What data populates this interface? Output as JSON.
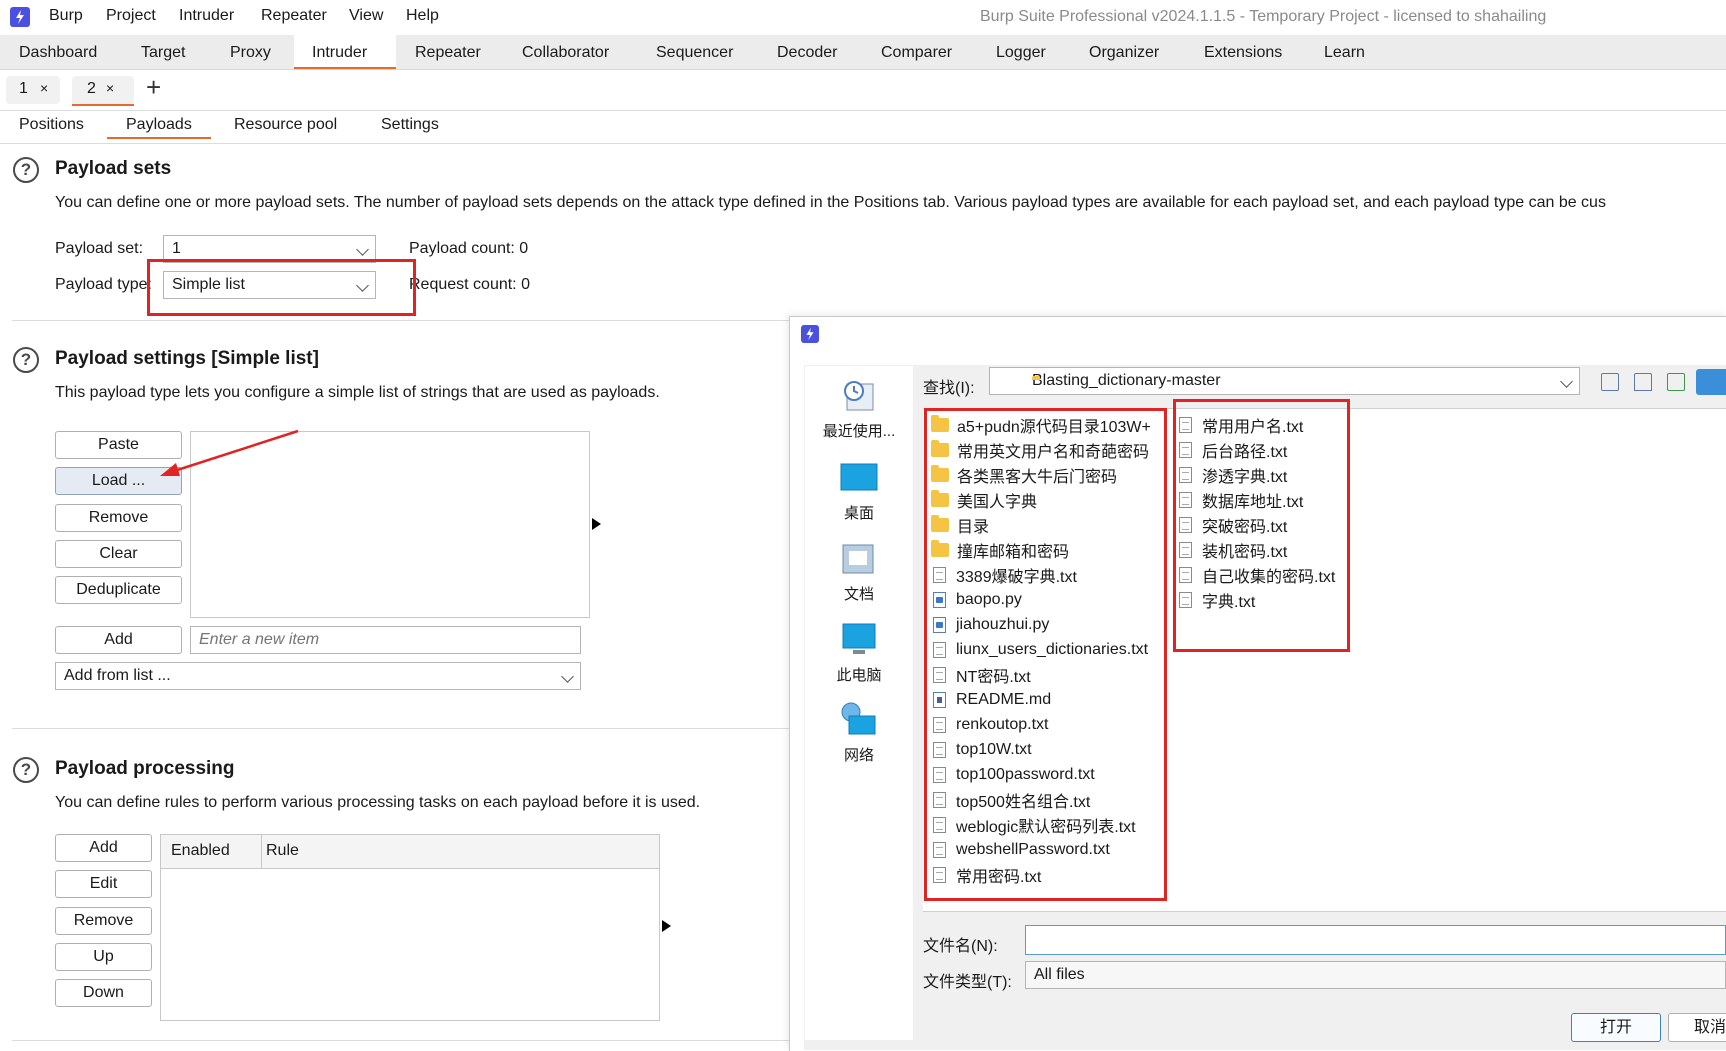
{
  "menubar": {
    "items": [
      "Burp",
      "Project",
      "Intruder",
      "Repeater",
      "View",
      "Help"
    ],
    "window_title": "Burp Suite Professional v2024.1.1.5 - Temporary Project - licensed to shahailing"
  },
  "main_tabs": [
    "Dashboard",
    "Target",
    "Proxy",
    "Intruder",
    "Repeater",
    "Collaborator",
    "Sequencer",
    "Decoder",
    "Comparer",
    "Logger",
    "Organizer",
    "Extensions",
    "Learn"
  ],
  "main_tab_active": "Intruder",
  "instance_tabs": [
    {
      "label": "1",
      "close": "×"
    },
    {
      "label": "2",
      "close": "×"
    }
  ],
  "instance_add": "+",
  "sub_tabs": [
    "Positions",
    "Payloads",
    "Resource pool",
    "Settings"
  ],
  "sub_tab_active": "Payloads",
  "payload_sets": {
    "help": "?",
    "title": "Payload sets",
    "description": "You can define one or more payload sets. The number of payload sets depends on the attack type defined in the Positions tab. Various payload types are available for each payload set, and each payload type can be cus",
    "set_label": "Payload set:",
    "set_value": "1",
    "type_label": "Payload type:",
    "type_value": "Simple list",
    "payload_count": "Payload count: 0",
    "request_count": "Request count: 0"
  },
  "payload_settings": {
    "help": "?",
    "title": "Payload settings [Simple list]",
    "description": "This payload type lets you configure a simple list of strings that are used as payloads.",
    "buttons": [
      "Paste",
      "Load ...",
      "Remove",
      "Clear",
      "Deduplicate"
    ],
    "add_button": "Add",
    "add_placeholder": "Enter a new item",
    "add_from_list": "Add from list ..."
  },
  "payload_processing": {
    "help": "?",
    "title": "Payload processing",
    "description": "You can define rules to perform various processing tasks on each payload before it is used.",
    "buttons": [
      "Add",
      "Edit",
      "Remove",
      "Up",
      "Down"
    ],
    "columns": [
      "Enabled",
      "Rule"
    ]
  },
  "file_dialog": {
    "look_in_label": "查找(I):",
    "look_in_value": "Blasting_dictionary-master",
    "places": [
      "最近使用...",
      "桌面",
      "文档",
      "此电脑",
      "网络"
    ],
    "files_left": [
      {
        "name": "a5+pudn源代码目录103W+",
        "type": "folder"
      },
      {
        "name": "常用英文用户名和奇葩密码",
        "type": "folder"
      },
      {
        "name": "各类黑客大牛后门密码",
        "type": "folder"
      },
      {
        "name": "美国人字典",
        "type": "folder"
      },
      {
        "name": "目录",
        "type": "folder"
      },
      {
        "name": "撞库邮箱和密码",
        "type": "folder"
      },
      {
        "name": "3389爆破字典.txt",
        "type": "txt"
      },
      {
        "name": "baopo.py",
        "type": "py"
      },
      {
        "name": "jiahouzhui.py",
        "type": "py"
      },
      {
        "name": "liunx_users_dictionaries.txt",
        "type": "txt"
      },
      {
        "name": "NT密码.txt",
        "type": "txt"
      },
      {
        "name": "README.md",
        "type": "md"
      },
      {
        "name": "renkoutop.txt",
        "type": "txt"
      },
      {
        "name": "top10W.txt",
        "type": "txt"
      },
      {
        "name": "top100password.txt",
        "type": "txt"
      },
      {
        "name": "top500姓名组合.txt",
        "type": "txt"
      },
      {
        "name": "weblogic默认密码列表.txt",
        "type": "txt"
      },
      {
        "name": "webshellPassword.txt",
        "type": "txt"
      },
      {
        "name": "常用密码.txt",
        "type": "txt"
      }
    ],
    "files_right": [
      {
        "name": "常用用户名.txt",
        "type": "txt"
      },
      {
        "name": "后台路径.txt",
        "type": "txt"
      },
      {
        "name": "渗透字典.txt",
        "type": "txt"
      },
      {
        "name": "数据库地址.txt",
        "type": "txt"
      },
      {
        "name": "突破密码.txt",
        "type": "txt"
      },
      {
        "name": "装机密码.txt",
        "type": "txt"
      },
      {
        "name": "自己收集的密码.txt",
        "type": "txt"
      },
      {
        "name": "字典.txt",
        "type": "txt"
      }
    ],
    "filename_label": "文件名(N):",
    "filename_value": "",
    "filetype_label": "文件类型(T):",
    "filetype_value": "All files",
    "open_button": "打开",
    "cancel_button": "取消"
  },
  "colors": {
    "accent": "#e8692c",
    "annotation_red": "#e02424",
    "burp_logo": "#4a50e0"
  }
}
